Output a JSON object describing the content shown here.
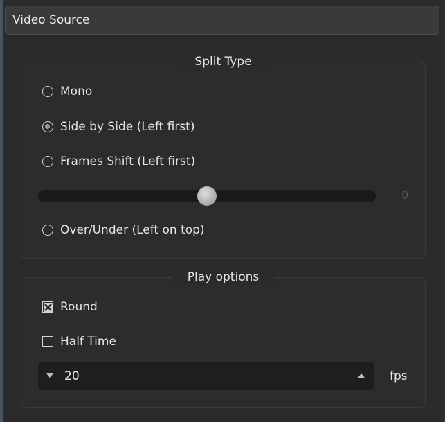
{
  "window": {
    "title": "Video Source"
  },
  "split_type": {
    "title": "Split Type",
    "options": [
      {
        "label": "Mono",
        "checked": false
      },
      {
        "label": "Side by Side (Left first)",
        "checked": true
      },
      {
        "label": "Frames Shift (Left first)",
        "checked": false
      },
      {
        "label": "Over/Under (Left on top)",
        "checked": false
      }
    ],
    "frames_shift_slider": {
      "value": "0",
      "level_fraction": 0.5
    }
  },
  "play_options": {
    "title": "Play options",
    "round": {
      "label": "Round",
      "checked": true
    },
    "half_time": {
      "label": "Half Time",
      "checked": false
    },
    "fps": {
      "value": "20",
      "unit": "fps"
    }
  }
}
